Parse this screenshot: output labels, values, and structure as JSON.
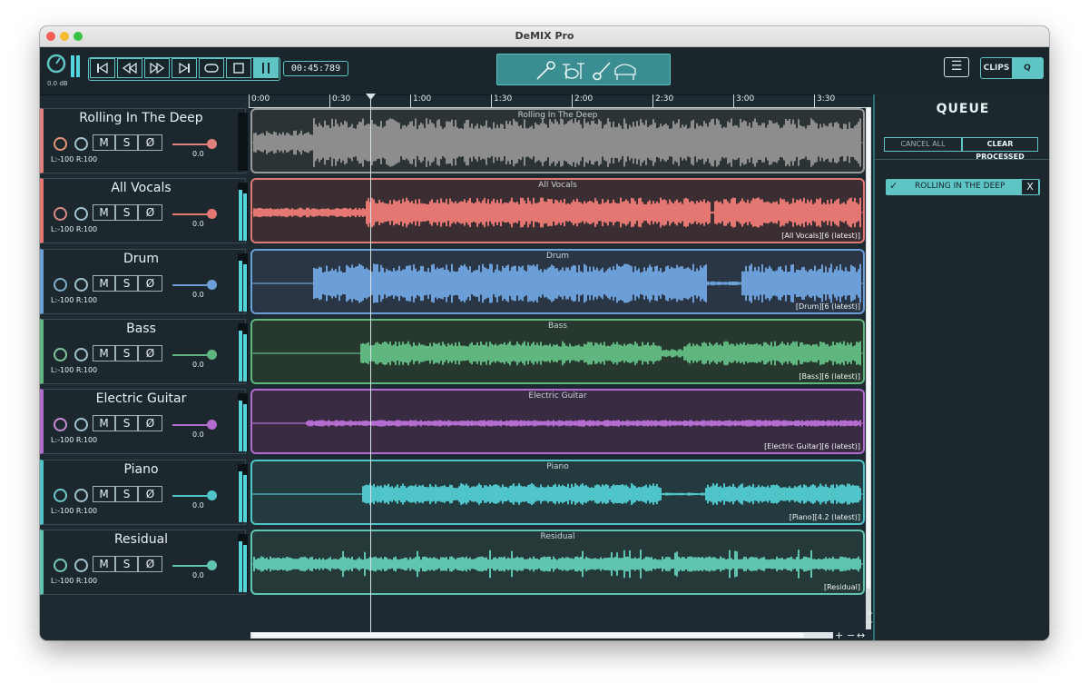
{
  "window": {
    "title": "DeMIX Pro"
  },
  "toolbar": {
    "master_db": "0.0 dB",
    "timecode": "00:45:789",
    "menu_icon": "hamburger-icon",
    "clips_label": "CLIPS",
    "queue_toggle_label": "Q"
  },
  "ruler": {
    "ticks": [
      "0:00",
      "0:30",
      "1:00",
      "1:30",
      "2:00",
      "2:30",
      "3:00",
      "3:30"
    ]
  },
  "tracks": [
    {
      "name": "Rolling In The Deep",
      "pan": "L:-100 R:100",
      "volume": "0.0",
      "lane_label": "Rolling In The Deep",
      "tag": "",
      "color": "#8d8d8d",
      "bg": "#2c3336",
      "accent": "#e2807d"
    },
    {
      "name": "All Vocals",
      "pan": "L:-100 R:100",
      "volume": "0.0",
      "lane_label": "All Vocals",
      "tag": "[All Vocals][6 (latest)]",
      "color": "#e57773",
      "bg": "#3a2e33",
      "accent": "#e57773"
    },
    {
      "name": "Drum",
      "pan": "L:-100 R:100",
      "volume": "0.0",
      "lane_label": "Drum",
      "tag": "[Drum][6 (latest)]",
      "color": "#6c9fd8",
      "bg": "#2a3546",
      "accent": "#6c9fd8"
    },
    {
      "name": "Bass",
      "pan": "L:-100 R:100",
      "volume": "0.0",
      "lane_label": "Bass",
      "tag": "[Bass][6 (latest)]",
      "color": "#5fb77f",
      "bg": "#27382f",
      "accent": "#5fb77f"
    },
    {
      "name": "Electric Guitar",
      "pan": "L:-100 R:100",
      "volume": "0.0",
      "lane_label": "Electric Guitar",
      "tag": "[Electric Guitar][6 (latest)]",
      "color": "#b56cd1",
      "bg": "#382b42",
      "accent": "#b56cd1"
    },
    {
      "name": "Piano",
      "pan": "L:-100 R:100",
      "volume": "0.0",
      "lane_label": "Piano",
      "tag": "[Piano][4.2 (latest)]",
      "color": "#4fc4c9",
      "bg": "#233a3f",
      "accent": "#4fc4c9"
    },
    {
      "name": "Residual",
      "pan": "L:-100 R:100",
      "volume": "0.0",
      "lane_label": "Residual",
      "tag": "[Residual]",
      "color": "#5fc4b0",
      "bg": "#253a38",
      "accent": "#5fc4b0"
    }
  ],
  "track_buttons": {
    "mute": "M",
    "solo": "S",
    "phase": "Ø"
  },
  "queue": {
    "title": "QUEUE",
    "cancel_all": "CANCEL ALL",
    "clear_processed": "CLEAR PROCESSED",
    "items": [
      {
        "label": "ROLLING IN THE DEEP",
        "remove": "X"
      }
    ]
  },
  "zoom": {
    "plus": "+",
    "minus": "−",
    "fit": "↔"
  }
}
